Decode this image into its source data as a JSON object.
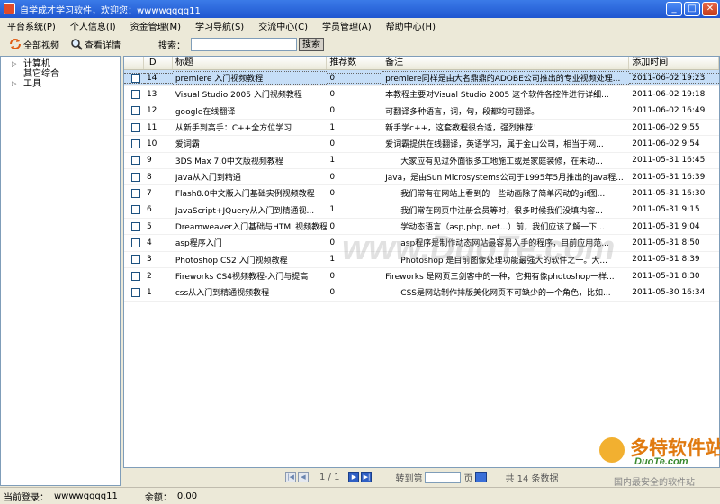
{
  "window": {
    "title": "自学成才学习软件，欢迎您：wwwwqqqq11"
  },
  "menu": [
    {
      "label": "平台系统(P)"
    },
    {
      "label": "个人信息(I)"
    },
    {
      "label": "资金管理(M)"
    },
    {
      "label": "学习导航(S)"
    },
    {
      "label": "交流中心(C)"
    },
    {
      "label": "学员管理(A)"
    },
    {
      "label": "帮助中心(H)"
    }
  ],
  "toolbar": {
    "all_videos_label": "全部视频",
    "view_details_label": "查看详情",
    "search_label": "搜索：",
    "search_value": "",
    "search_button_label": "搜索"
  },
  "tree": {
    "nodes": [
      {
        "label": "计算机"
      },
      {
        "label": "其它综合"
      },
      {
        "label": "工具"
      }
    ]
  },
  "grid": {
    "headers": {
      "id": "ID",
      "title": "标题",
      "recommend": "推荐数",
      "note": "备注",
      "added": "添加时间"
    },
    "rows": [
      {
        "id": "14",
        "title": "premiere 入门视频教程",
        "recommend": "0",
        "note": "premiere同样是由大名鼎鼎的ADOBE公司推出的专业视频处理...",
        "added": "2011-06-02 19:23"
      },
      {
        "id": "13",
        "title": "Visual Studio 2005 入门视频教程",
        "recommend": "0",
        "note": "本教程主要对Visual Studio 2005 这个软件各控件进行详细...",
        "added": "2011-06-02 19:18"
      },
      {
        "id": "12",
        "title": "google在线翻译",
        "recommend": "0",
        "note": "可翻译多种语言，词，句，段都均可翻译。",
        "added": "2011-06-02 16:49"
      },
      {
        "id": "11",
        "title": "从新手到高手：C++全方位学习",
        "recommend": "1",
        "note": "新手学c++，这套教程很合适，强烈推荐！",
        "added": "2011-06-02 9:55"
      },
      {
        "id": "10",
        "title": "爱词霸",
        "recommend": "0",
        "note": "爱词霸提供在线翻译，英语学习，属于金山公司，相当于网...",
        "added": "2011-06-02 9:54"
      },
      {
        "id": "9",
        "title": "3DS Max 7.0中文版视频教程",
        "recommend": "1",
        "note": "      大家应有见过外面很多工地施工或是家庭装修，在未动...",
        "added": "2011-05-31 16:45"
      },
      {
        "id": "8",
        "title": "Java从入门到精通",
        "recommend": "0",
        "note": "Java，是由Sun Microsystems公司于1995年5月推出的Java程...",
        "added": "2011-05-31 16:39"
      },
      {
        "id": "7",
        "title": "Flash8.0中文版入门基础实例视频教程",
        "recommend": "0",
        "note": "      我们常有在网站上看到的一些动画除了简单闪动的gif图...",
        "added": "2011-05-31 16:30"
      },
      {
        "id": "6",
        "title": "JavaScript+JQuery从入门到精通视...",
        "recommend": "1",
        "note": "      我们常在网页中注册会员等时，很多时候我们没填内容...",
        "added": "2011-05-31 9:15"
      },
      {
        "id": "5",
        "title": "Dreamweaver入门基础与HTML视频教程",
        "recommend": "0",
        "note": "      学动态语言（asp,php,.net...）前，我们应该了解一下...",
        "added": "2011-05-31 9:04"
      },
      {
        "id": "4",
        "title": "asp程序入门",
        "recommend": "0",
        "note": "      asp程序是制作动态网站最容易入手的程序，目前应用范...",
        "added": "2011-05-31 8:50"
      },
      {
        "id": "3",
        "title": "Photoshop CS2 入门视频教程",
        "recommend": "1",
        "note": "      Photoshop 是目前图像处理功能最强大的软件之一。大...",
        "added": "2011-05-31 8:39"
      },
      {
        "id": "2",
        "title": "Fireworks CS4视频教程-入门与提高",
        "recommend": "0",
        "note": "Fireworks 是网页三剑客中的一种，它拥有像photoshop一样...",
        "added": "2011-05-31 8:30"
      },
      {
        "id": "1",
        "title": "css从入门到精通视频教程",
        "recommend": "0",
        "note": "      CSS是网站制作排版美化网页不可缺少的一个角色，比如...",
        "added": "2011-05-30 16:34"
      }
    ]
  },
  "pager": {
    "page_text": "1 / 1",
    "jump_label": "转到第",
    "jump_value": "",
    "page_unit": "页",
    "total_text": "共 14 条数据"
  },
  "status": {
    "login_label": "当前登录：",
    "login_user": "wwwwqqqq11",
    "balance_label": "余额：",
    "balance_value": "0.00"
  },
  "watermark": {
    "text": "www.DuoTe.com"
  },
  "logo": {
    "main": "多特软件站",
    "sub": "DuoTe.com",
    "foot": "国内最安全的软件站"
  }
}
